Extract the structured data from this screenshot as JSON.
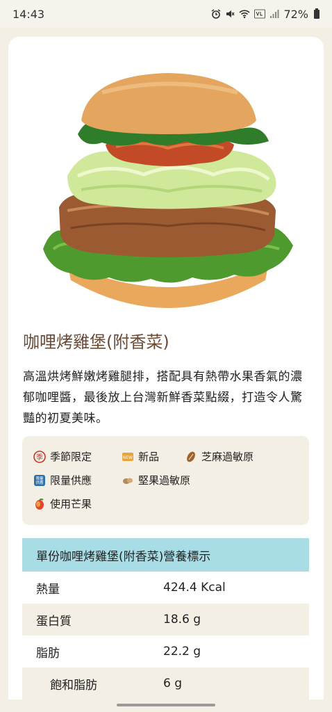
{
  "status": {
    "time": "14:43",
    "battery": "72%",
    "icons": [
      "alarm-icon",
      "mute-icon",
      "wifi-icon",
      "volte-icon",
      "signal-icon",
      "battery-icon"
    ]
  },
  "product": {
    "title": "咖哩烤雞堡(附香菜)",
    "description": "高溫烘烤鮮嫩烤雞腿排，搭配具有熱帶水果香氣的濃郁咖哩醬，最後放上台灣新鮮香菜點綴，打造令人驚豔的初夏美味。",
    "image_icon": "burger-image"
  },
  "tags": [
    {
      "label": "季節限定",
      "icon": "seasonal-icon"
    },
    {
      "label": "新品",
      "icon": "new-icon"
    },
    {
      "label": "芝麻過敏原",
      "icon": "sesame-icon"
    },
    {
      "label": "限量供應",
      "icon": "limited-icon"
    },
    {
      "label": "堅果過敏原",
      "icon": "nut-icon"
    },
    {
      "label": "使用芒果",
      "icon": "mango-icon"
    }
  ],
  "limited_icon_text": "限量供應",
  "new_icon_text": "NEW",
  "nutrition": {
    "header": "單份咖哩烤雞堡(附香菜)營養標示",
    "rows": [
      {
        "label": "熱量",
        "value": "424.4 Kcal"
      },
      {
        "label": "蛋白質",
        "value": "18.6 g"
      },
      {
        "label": "脂肪",
        "value": "22.2 g"
      },
      {
        "label": "飽和脂肪",
        "value": "6 g"
      }
    ]
  }
}
